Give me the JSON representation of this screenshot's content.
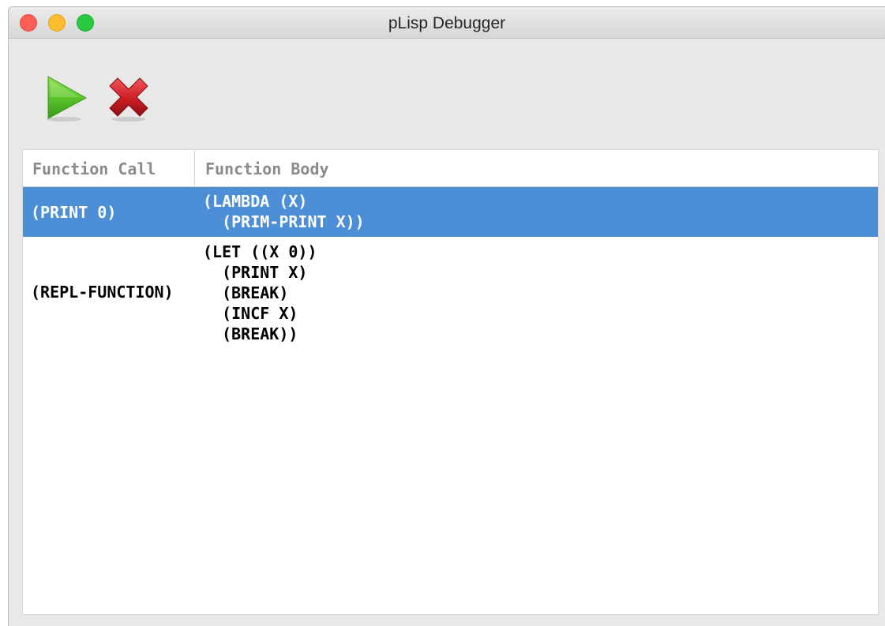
{
  "window": {
    "title": "pLisp Debugger"
  },
  "toolbar": {
    "continue_icon": "play-icon",
    "abort_icon": "close-x-icon",
    "continue_color": "#5cc42a",
    "abort_color": "#d0202a"
  },
  "table": {
    "columns": [
      "Function Call",
      "Function Body"
    ],
    "rows": [
      {
        "call": "(PRINT 0)",
        "body": "(LAMBDA (X)\n  (PRIM-PRINT X))",
        "selected": true
      },
      {
        "call": "(REPL-FUNCTION)",
        "body": "(LET ((X 0))\n  (PRINT X)\n  (BREAK)\n  (INCF X)\n  (BREAK))",
        "selected": false
      }
    ]
  },
  "colors": {
    "selection": "#4d8fd6",
    "header_text": "#8a8a8a"
  }
}
